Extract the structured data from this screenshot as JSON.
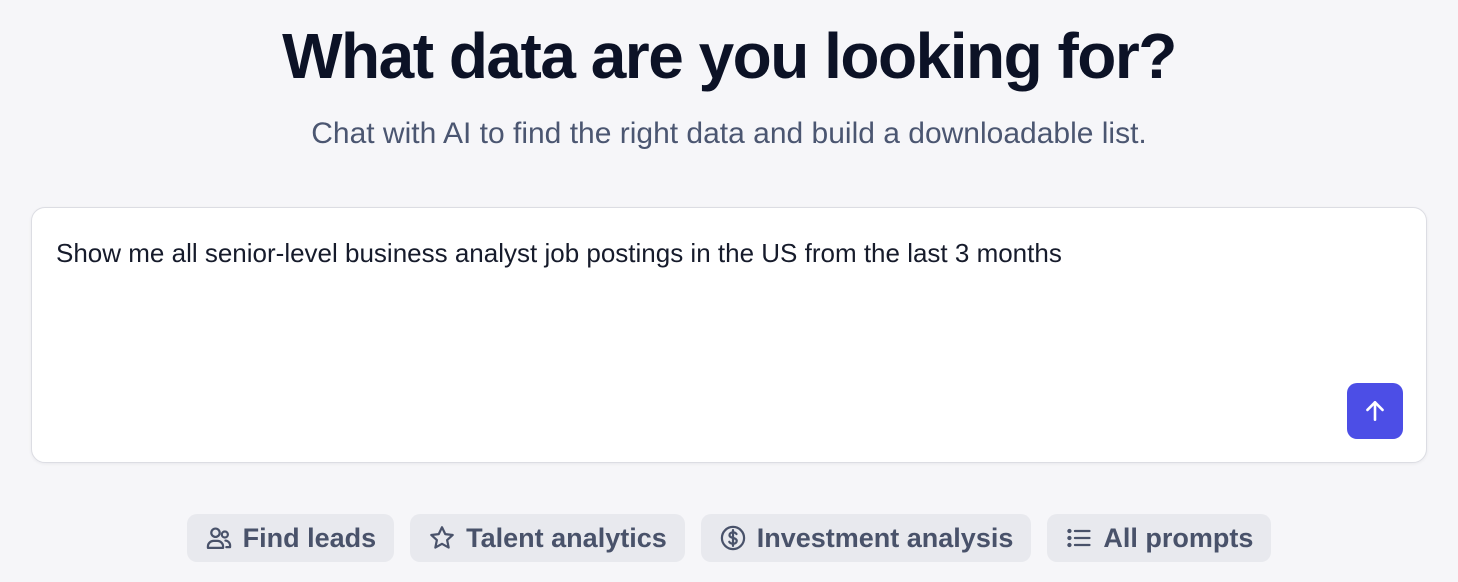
{
  "header": {
    "title": "What data are you looking for?",
    "subtitle": "Chat with AI to find the right data and build a downloadable list."
  },
  "prompt": {
    "value": "Show me all senior-level business analyst job postings in the US from the last 3 months",
    "send_icon": "arrow-up-icon"
  },
  "chips": [
    {
      "label": "Find leads",
      "icon": "users-icon"
    },
    {
      "label": "Talent analytics",
      "icon": "star-icon"
    },
    {
      "label": "Investment analysis",
      "icon": "dollar-circle-icon"
    },
    {
      "label": "All prompts",
      "icon": "list-icon"
    }
  ],
  "colors": {
    "background": "#f6f6f9",
    "accent": "#4c4ee6",
    "chip_background": "#e8e9ee"
  }
}
